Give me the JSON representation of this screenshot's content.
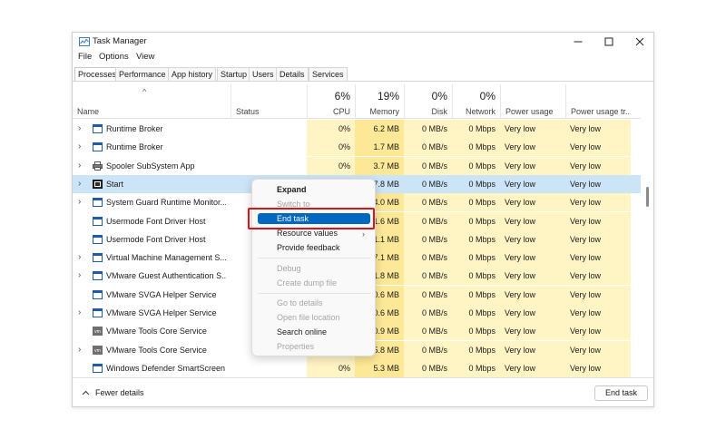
{
  "window": {
    "title": "Task Manager",
    "controls": {
      "minimize": "minimize-icon",
      "maximize": "maximize-icon",
      "close": "close-icon"
    }
  },
  "menu": [
    "File",
    "Options",
    "View"
  ],
  "tabs": [
    "Processes",
    "Performance",
    "App history",
    "Startup",
    "Users",
    "Details",
    "Services"
  ],
  "active_tab": "Processes",
  "columns": {
    "name": "Name",
    "status": "Status",
    "cpu": {
      "pct": "6%",
      "label": "CPU"
    },
    "memory": {
      "pct": "19%",
      "label": "Memory"
    },
    "disk": {
      "pct": "0%",
      "label": "Disk"
    },
    "network": {
      "pct": "0%",
      "label": "Network"
    },
    "power": "Power usage",
    "power_trend": "Power usage tr..."
  },
  "rows": [
    {
      "name": "Runtime Broker",
      "expand": true,
      "icon": "window-icon",
      "cpu": "0%",
      "mem": "6.2 MB",
      "disk": "0 MB/s",
      "net": "0 Mbps",
      "power": "Very low",
      "trend": "Very low"
    },
    {
      "name": "Runtime Broker",
      "expand": true,
      "icon": "window-icon",
      "cpu": "0%",
      "mem": "1.7 MB",
      "disk": "0 MB/s",
      "net": "0 Mbps",
      "power": "Very low",
      "trend": "Very low"
    },
    {
      "name": "Spooler SubSystem App",
      "expand": true,
      "icon": "printer-icon",
      "cpu": "0%",
      "mem": "3.7 MB",
      "disk": "0 MB/s",
      "net": "0 Mbps",
      "power": "Very low",
      "trend": "Very low"
    },
    {
      "name": "Start",
      "expand": true,
      "icon": "start-icon",
      "cpu": "",
      "mem": "7.8 MB",
      "disk": "0 MB/s",
      "net": "0 Mbps",
      "power": "Very low",
      "trend": "Very low",
      "selected": true
    },
    {
      "name": "System Guard Runtime Monitor...",
      "expand": true,
      "icon": "window-icon",
      "cpu": "",
      "mem": "4.0 MB",
      "disk": "0 MB/s",
      "net": "0 Mbps",
      "power": "Very low",
      "trend": "Very low"
    },
    {
      "name": "Usermode Font Driver Host",
      "expand": false,
      "icon": "window-icon",
      "cpu": "",
      "mem": "1.6 MB",
      "disk": "0 MB/s",
      "net": "0 Mbps",
      "power": "Very low",
      "trend": "Very low"
    },
    {
      "name": "Usermode Font Driver Host",
      "expand": false,
      "icon": "window-icon",
      "cpu": "",
      "mem": "1.1 MB",
      "disk": "0 MB/s",
      "net": "0 Mbps",
      "power": "Very low",
      "trend": "Very low"
    },
    {
      "name": "Virtual Machine Management S...",
      "expand": true,
      "icon": "window-icon",
      "cpu": "",
      "mem": "7.1 MB",
      "disk": "0 MB/s",
      "net": "0 Mbps",
      "power": "Very low",
      "trend": "Very low"
    },
    {
      "name": "VMware Guest Authentication S...",
      "expand": true,
      "icon": "window-icon",
      "cpu": "",
      "mem": "1.8 MB",
      "disk": "0 MB/s",
      "net": "0 Mbps",
      "power": "Very low",
      "trend": "Very low"
    },
    {
      "name": "VMware SVGA Helper Service",
      "expand": false,
      "icon": "window-icon",
      "cpu": "",
      "mem": "0.6 MB",
      "disk": "0 MB/s",
      "net": "0 Mbps",
      "power": "Very low",
      "trend": "Very low"
    },
    {
      "name": "VMware SVGA Helper Service",
      "expand": true,
      "icon": "window-icon",
      "cpu": "",
      "mem": "0.6 MB",
      "disk": "0 MB/s",
      "net": "0 Mbps",
      "power": "Very low",
      "trend": "Very low"
    },
    {
      "name": "VMware Tools Core Service",
      "expand": false,
      "icon": "vmware-icon",
      "cpu": "",
      "mem": "0.9 MB",
      "disk": "0 MB/s",
      "net": "0 Mbps",
      "power": "Very low",
      "trend": "Very low"
    },
    {
      "name": "VMware Tools Core Service",
      "expand": true,
      "icon": "vmware-icon",
      "cpu": "",
      "mem": "5.8 MB",
      "disk": "0 MB/s",
      "net": "0 Mbps",
      "power": "Very low",
      "trend": "Very low"
    },
    {
      "name": "Windows Defender SmartScreen",
      "expand": false,
      "icon": "window-icon",
      "cpu": "0%",
      "mem": "5.3 MB",
      "disk": "0 MB/s",
      "net": "0 Mbps",
      "power": "Very low",
      "trend": "Very low"
    }
  ],
  "context_menu": {
    "expand": "Expand",
    "switch_to": "Switch to",
    "end_task": "End task",
    "resource_values": "Resource values",
    "provide_feedback": "Provide feedback",
    "debug": "Debug",
    "create_dump": "Create dump file",
    "go_to_details": "Go to details",
    "open_file_location": "Open file location",
    "search_online": "Search online",
    "properties": "Properties"
  },
  "footer": {
    "fewer_details": "Fewer details",
    "end_task_button": "End task"
  },
  "colors": {
    "selection": "#cce4f7",
    "heat_light": "#fff4c4",
    "heat_medium": "#fce896",
    "menu_highlight": "#0067c0",
    "callout": "#d9141b"
  }
}
